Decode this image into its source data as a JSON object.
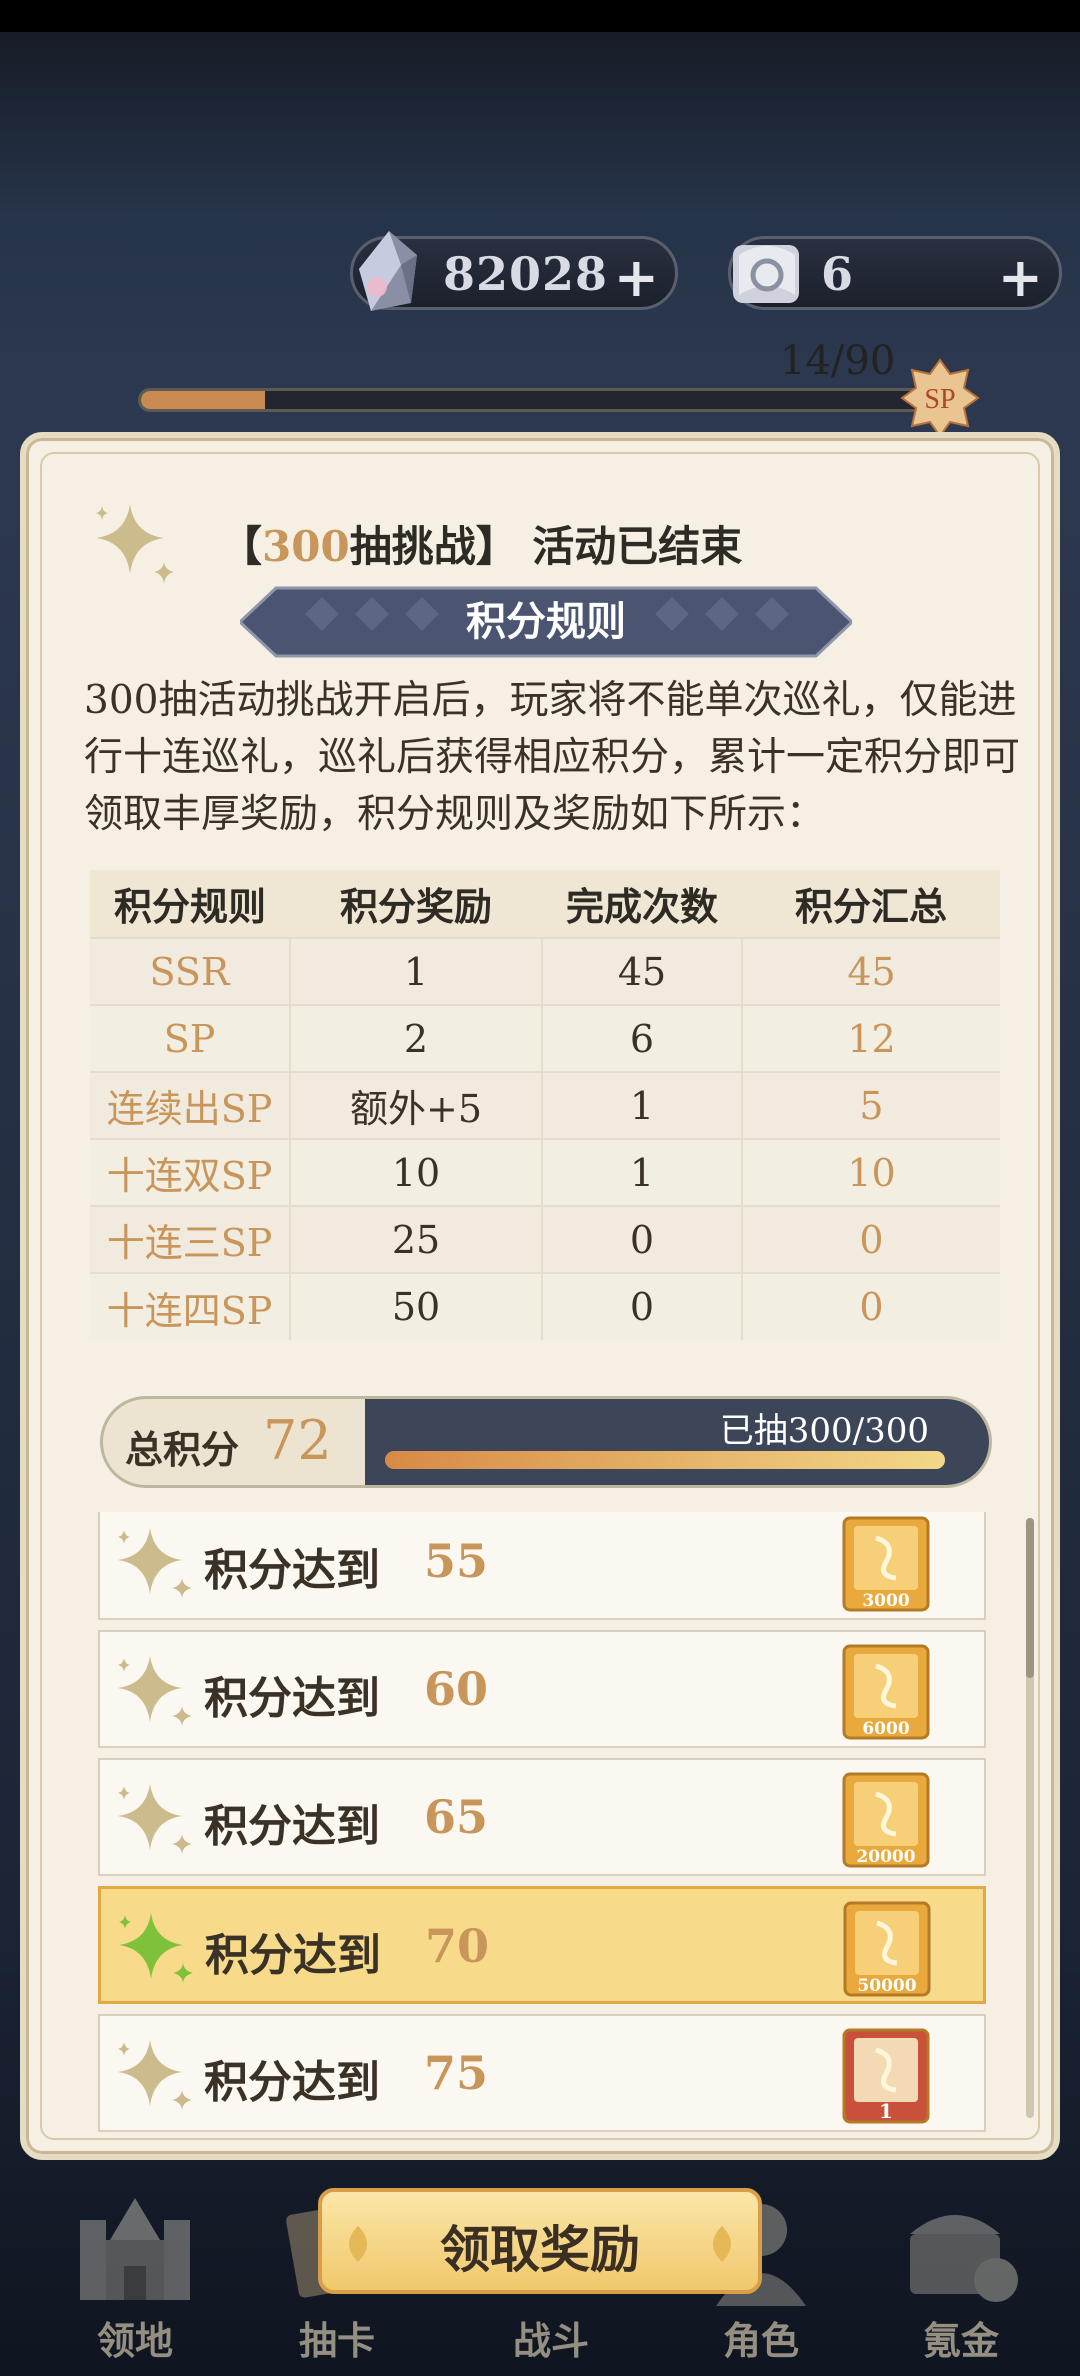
{
  "currencies": [
    {
      "icon": "crystal-icon",
      "value": "82028",
      "plus": "+"
    },
    {
      "icon": "ticket-scroll-icon",
      "value": "6",
      "plus": "+"
    }
  ],
  "pity": {
    "count": "14/90",
    "fraction": 0.1556,
    "badge": "SP"
  },
  "panel": {
    "title_bracket_open": "【",
    "title_highlight": "300",
    "title_rest": "抽挑战】 活动已结束",
    "section_title": "积分规则",
    "description": "300抽活动挑战开启后，玩家将不能单次巡礼，仅能进行十连巡礼，巡礼后获得相应积分，累计一定积分即可领取丰厚奖励，积分规则及奖励如下所示："
  },
  "table": {
    "headers": [
      "积分规则",
      "积分奖励",
      "完成次数",
      "积分汇总"
    ],
    "rows": [
      [
        "SSR",
        "1",
        "45",
        "45"
      ],
      [
        "SP",
        "2",
        "6",
        "12"
      ],
      [
        "连续出SP",
        "额外+5",
        "1",
        "5"
      ],
      [
        "十连双SP",
        "10",
        "1",
        "10"
      ],
      [
        "十连三SP",
        "25",
        "0",
        "0"
      ],
      [
        "十连四SP",
        "50",
        "0",
        "0"
      ]
    ]
  },
  "total": {
    "label": "总积分",
    "value": "72",
    "drawn": "已抽300/300",
    "progress": 1.0
  },
  "rewards": [
    {
      "label": "积分达到",
      "target": "55",
      "amount": "3000",
      "active": false
    },
    {
      "label": "积分达到",
      "target": "60",
      "amount": "6000",
      "active": false
    },
    {
      "label": "积分达到",
      "target": "65",
      "amount": "20000",
      "active": false
    },
    {
      "label": "积分达到",
      "target": "70",
      "amount": "50000",
      "active": true
    },
    {
      "label": "积分达到",
      "target": "75",
      "amount": "1",
      "active": false
    }
  ],
  "nav": [
    {
      "label": "领地",
      "icon": "castle-icon"
    },
    {
      "label": "抽卡",
      "icon": "card-icon"
    },
    {
      "label": "战斗",
      "icon": "battle-icon"
    },
    {
      "label": "角色",
      "icon": "character-icon"
    },
    {
      "label": "氪金",
      "icon": "treasure-chest-icon"
    }
  ],
  "claim_button": "领取奖励",
  "colors": {
    "accent": "#c8955a",
    "dark": "#3d4559",
    "panel": "#f5f0e3",
    "active_row": "#f8db8a"
  }
}
